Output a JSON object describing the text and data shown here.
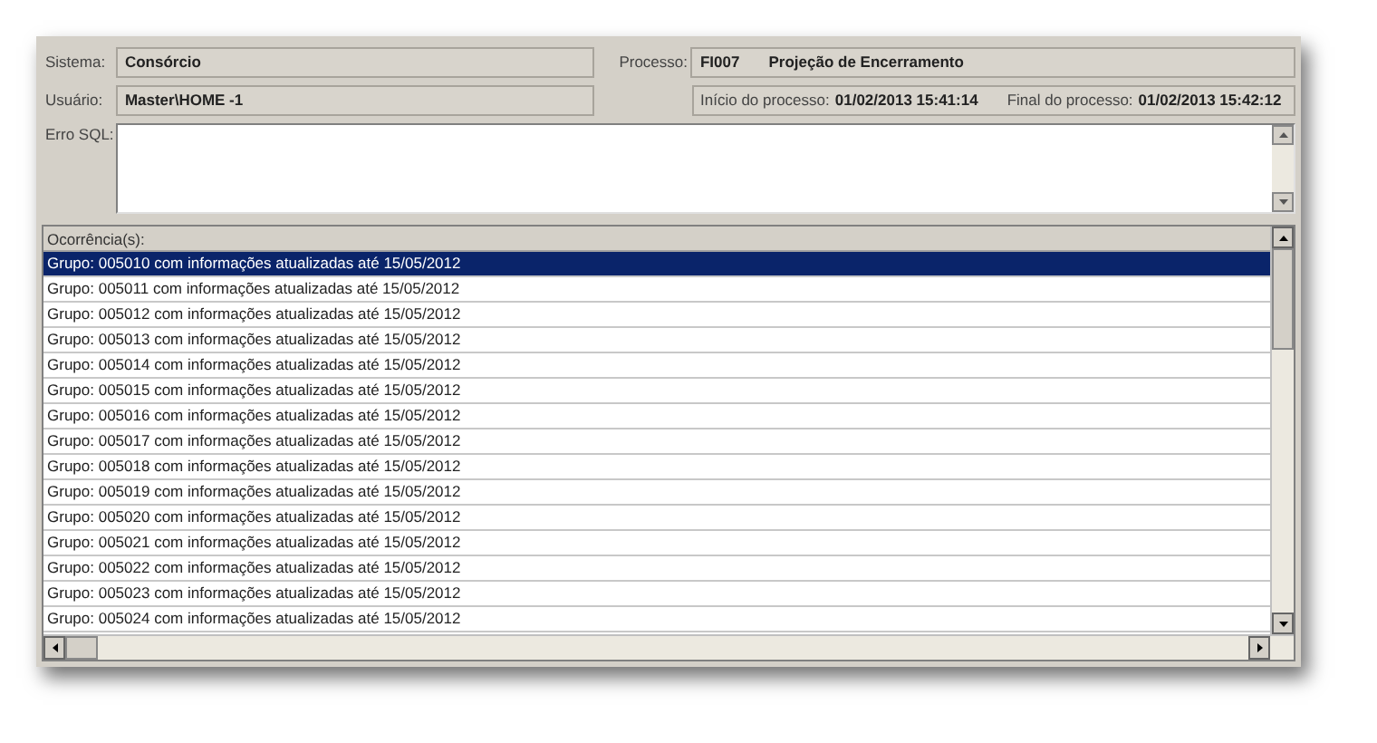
{
  "fields": {
    "sistema": {
      "label": "Sistema:",
      "value": "Consórcio"
    },
    "processo": {
      "label": "Processo:",
      "code": "FI007",
      "value": "Projeção de Encerramento"
    },
    "usuario": {
      "label": "Usuário:",
      "value": "Master\\HOME -1"
    },
    "inicio": {
      "label": "Início do processo:",
      "value": "01/02/2013 15:41:14"
    },
    "final": {
      "label": "Final do processo:",
      "value": "01/02/2013 15:42:12"
    },
    "erro_sql": {
      "label": "Erro SQL:"
    }
  },
  "list": {
    "header": "Ocorrência(s):",
    "rows": [
      {
        "text": "Grupo: 005010 com informações atualizadas até 15/05/2012",
        "selected": true
      },
      {
        "text": "Grupo: 005011 com informações atualizadas até 15/05/2012",
        "selected": false
      },
      {
        "text": "Grupo: 005012 com informações atualizadas até 15/05/2012",
        "selected": false
      },
      {
        "text": "Grupo: 005013 com informações atualizadas até 15/05/2012",
        "selected": false
      },
      {
        "text": "Grupo: 005014 com informações atualizadas até 15/05/2012",
        "selected": false
      },
      {
        "text": "Grupo: 005015 com informações atualizadas até 15/05/2012",
        "selected": false
      },
      {
        "text": "Grupo: 005016 com informações atualizadas até 15/05/2012",
        "selected": false
      },
      {
        "text": "Grupo: 005017 com informações atualizadas até 15/05/2012",
        "selected": false
      },
      {
        "text": "Grupo: 005018 com informações atualizadas até 15/05/2012",
        "selected": false
      },
      {
        "text": "Grupo: 005019 com informações atualizadas até 15/05/2012",
        "selected": false
      },
      {
        "text": "Grupo: 005020 com informações atualizadas até 15/05/2012",
        "selected": false
      },
      {
        "text": "Grupo: 005021 com informações atualizadas até 15/05/2012",
        "selected": false
      },
      {
        "text": "Grupo: 005022 com informações atualizadas até 15/05/2012",
        "selected": false
      },
      {
        "text": "Grupo: 005023 com informações atualizadas até 15/05/2012",
        "selected": false
      },
      {
        "text": "Grupo: 005024 com informações atualizadas até 15/05/2012",
        "selected": false
      }
    ]
  }
}
